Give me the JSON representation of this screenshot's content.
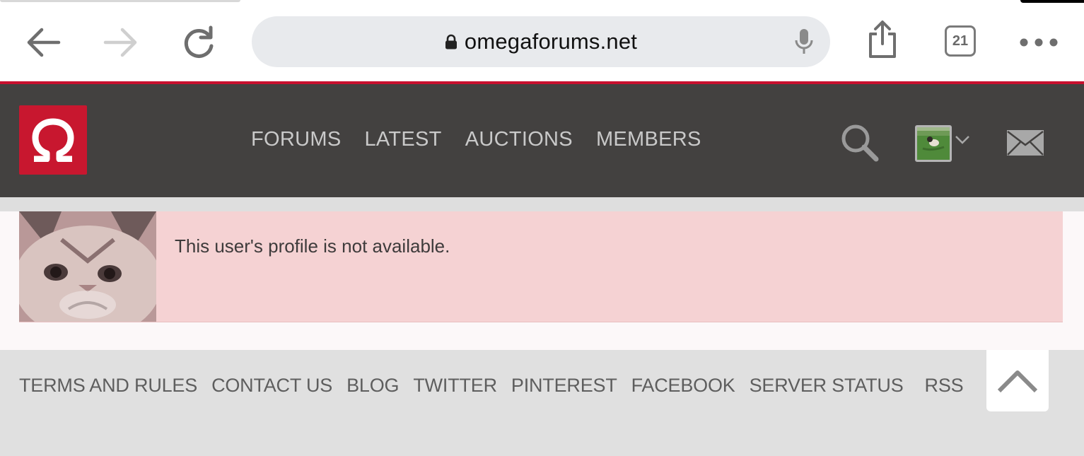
{
  "browser": {
    "url": "omegaforums.net",
    "tab_count": "21",
    "icons": [
      "back-arrow-icon",
      "forward-arrow-icon",
      "reload-icon",
      "lock-icon",
      "microphone-icon",
      "share-icon",
      "tabs-icon",
      "more-icon"
    ]
  },
  "site": {
    "logo_glyph": "Ω",
    "nav": [
      "FORUMS",
      "LATEST",
      "AUCTIONS",
      "MEMBERS"
    ],
    "accent_color": "#c8172f",
    "header_bg": "#434140"
  },
  "message": {
    "text": "This user's profile is not available.",
    "bg_color": "#f5d2d3"
  },
  "footer": {
    "links": [
      "TERMS AND RULES",
      "CONTACT US",
      "BLOG",
      "TWITTER",
      "PINTEREST",
      "FACEBOOK",
      "SERVER STATUS",
      "RSS"
    ]
  }
}
